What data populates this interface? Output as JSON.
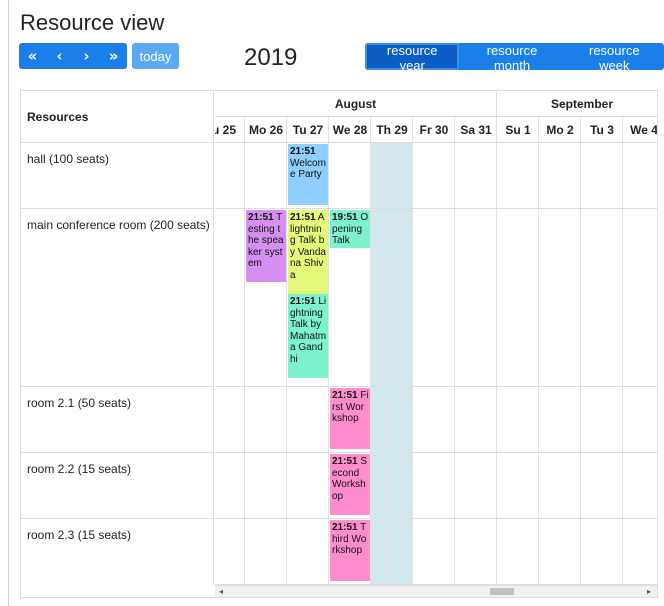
{
  "page": {
    "title": "Resource view"
  },
  "toolbar": {
    "prev_year": "«",
    "prev": "‹",
    "next": "›",
    "next_year": "»",
    "today": "today",
    "title": "2019",
    "views": [
      {
        "label": "resource year",
        "active": true
      },
      {
        "label": "resource month",
        "active": false
      },
      {
        "label": "resource week",
        "active": false
      }
    ]
  },
  "calendar": {
    "resources_header": "Resources",
    "months": [
      {
        "label": "August"
      },
      {
        "label": "September"
      }
    ],
    "days": [
      "u 25",
      "Mo 26",
      "Tu 27",
      "We 28",
      "Th 29",
      "Fr 30",
      "Sa 31",
      "Su 1",
      "Mo 2",
      "Tu 3",
      "We 4"
    ],
    "today_index": 4,
    "resources": [
      {
        "label": "hall (100 seats)"
      },
      {
        "label": "main conference room (200 seats)"
      },
      {
        "label": "room 2.1 (50 seats)"
      },
      {
        "label": "room 2.2 (15 seats)"
      },
      {
        "label": "room 2.3 (15 seats)"
      }
    ],
    "events": [
      {
        "time": "21:51",
        "title": "Welcome Party",
        "resource": 0,
        "day": 2,
        "slot": 0,
        "lines": 5,
        "color": "#8ecfff"
      },
      {
        "time": "21:51",
        "title": "Testing the speaker system",
        "resource": 1,
        "day": 1,
        "slot": 0,
        "lines": 6,
        "color": "#d58ff0"
      },
      {
        "time": "21:51",
        "title": "A lightning Talk by Vandana Shiva",
        "resource": 1,
        "day": 2,
        "slot": 0,
        "lines": 7,
        "color": "#e3f97a"
      },
      {
        "time": "19:51",
        "title": "Opening Talk",
        "resource": 1,
        "day": 3,
        "slot": 0,
        "lines": 3,
        "color": "#7ef2cf"
      },
      {
        "time": "21:51",
        "title": "Lightning Talk by Mahatma Gandhi",
        "resource": 1,
        "day": 2,
        "slot": 1,
        "lines": 7,
        "color": "#7ef2cf"
      },
      {
        "time": "21:51",
        "title": "First Workshop",
        "resource": 2,
        "day": 3,
        "slot": 0,
        "lines": 5,
        "color": "#ff8ccc"
      },
      {
        "time": "21:51",
        "title": "Second Workshop",
        "resource": 3,
        "day": 3,
        "slot": 0,
        "lines": 5,
        "color": "#ff8ccc"
      },
      {
        "time": "21:51",
        "title": "Third Workshop",
        "resource": 4,
        "day": 3,
        "slot": 0,
        "lines": 5,
        "color": "#ff8ccc"
      }
    ]
  },
  "scrollbar": {
    "left_arrow": "◂",
    "right_arrow": "▸"
  }
}
